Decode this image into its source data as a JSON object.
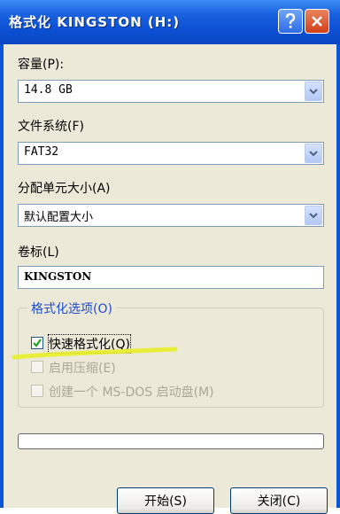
{
  "window": {
    "title": "格式化 KINGSTON (H:)"
  },
  "capacity": {
    "label": "容量(P):",
    "value": "14.8 GB"
  },
  "filesystem": {
    "label": "文件系统(F)",
    "value": "FAT32"
  },
  "allocation": {
    "label": "分配单元大小(A)",
    "value": "默认配置大小"
  },
  "volume": {
    "label": "卷标(L)",
    "value": "KINGSTON"
  },
  "options": {
    "title": "格式化选项(O)",
    "quick_format": {
      "label": "快速格式化(Q)",
      "checked": true
    },
    "compression": {
      "label": "启用压缩(E)",
      "checked": false,
      "enabled": false
    },
    "msdos_boot": {
      "label": "创建一个 MS-DOS 启动盘(M)",
      "checked": false,
      "enabled": false
    }
  },
  "progress": {
    "value": 0
  },
  "buttons": {
    "start": "开始(S)",
    "close": "关闭(C)"
  },
  "colors": {
    "titlebar": "#0b4fd2",
    "client_bg": "#ece9d8",
    "group_title": "#1f4ccf",
    "highlight": "#e8ef2a",
    "close_button": "#d0401a"
  },
  "icons": {
    "help": "question-mark-icon",
    "close": "x-icon",
    "dropdown": "chevron-down-icon",
    "check": "checkmark-icon"
  }
}
